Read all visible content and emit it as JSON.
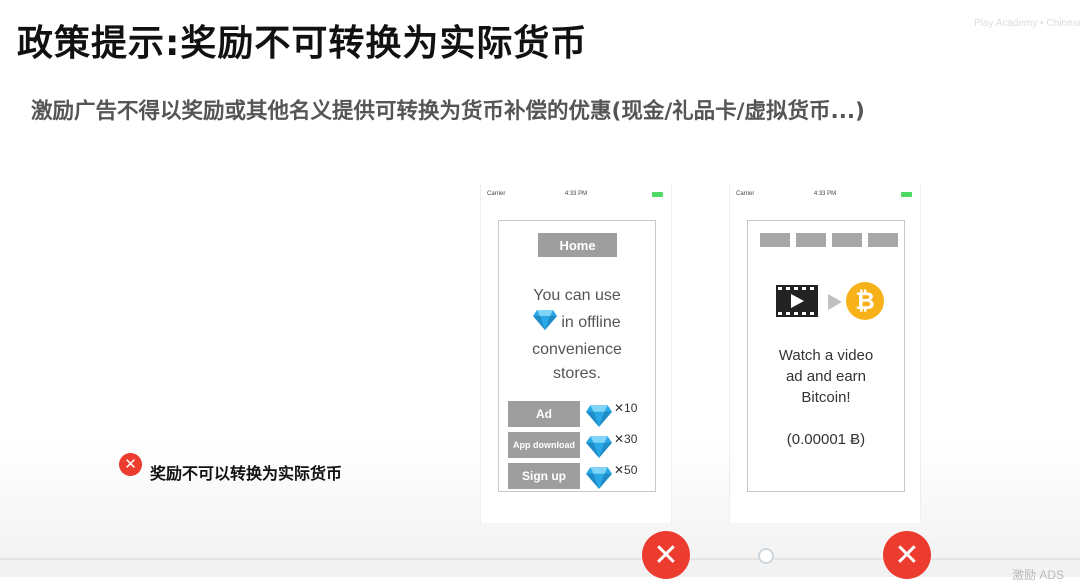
{
  "slide": {
    "title": "政策提示:奖励不可转换为实际货币",
    "subtitle": "激励广告不得以奖励或其他名义提供可转换为货币补偿的优惠(现金/礼品卡/虚拟货币...)",
    "watermark": "Play Academy • Chinese",
    "footer_note": "激励 ADS",
    "note_text": "奖励不可以转换为实际货币",
    "reject_color": "#ec3b2f"
  },
  "phone1": {
    "carrier": "Carrier",
    "time": "4:33 PM",
    "home_button": "Home",
    "msg_line1": "You can use",
    "msg_line2": "in offline",
    "msg_line3": "convenience",
    "msg_line4": "stores.",
    "rows": [
      {
        "label": "Ad",
        "multiplier": "✕10"
      },
      {
        "label": "App download",
        "multiplier": "✕30"
      },
      {
        "label": "Sign up",
        "multiplier": "✕50"
      }
    ],
    "icon": "diamond-icon"
  },
  "phone2": {
    "carrier": "Carrier",
    "time": "4:33 PM",
    "msg_line1": "Watch a video",
    "msg_line2": "ad and earn",
    "msg_line3": "Bitcoin!",
    "amount": "(0.00001 Ƀ)",
    "bitcoin_symbol": "₿",
    "icons": [
      "film-icon",
      "arrow-right-icon",
      "bitcoin-icon"
    ],
    "bitcoin_color": "#f7b21a"
  }
}
